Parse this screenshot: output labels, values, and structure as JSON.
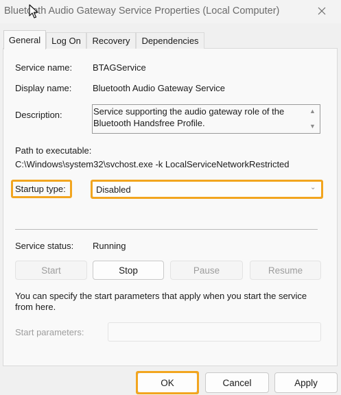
{
  "window": {
    "title": "Bluetooth Audio Gateway Service Properties (Local Computer)"
  },
  "tabs": [
    "General",
    "Log On",
    "Recovery",
    "Dependencies"
  ],
  "fields": {
    "service_name_label": "Service name:",
    "service_name_value": "BTAGService",
    "display_name_label": "Display name:",
    "display_name_value": "Bluetooth Audio Gateway Service",
    "description_label": "Description:",
    "description_line1": "Service supporting the audio gateway role of the",
    "description_line2": "Bluetooth Handsfree Profile.",
    "path_label": "Path to executable:",
    "path_value": "C:\\Windows\\system32\\svchost.exe -k LocalServiceNetworkRestricted",
    "startup_type_label": "Startup type:",
    "startup_type_value": "Disabled",
    "service_status_label": "Service status:",
    "service_status_value": "Running"
  },
  "control_buttons": {
    "start": "Start",
    "stop": "Stop",
    "pause": "Pause",
    "resume": "Resume"
  },
  "help_line1": "You can specify the start parameters that apply when you start the service",
  "help_line2": "from here.",
  "start_parameters_label": "Start parameters:",
  "footer": {
    "ok": "OK",
    "cancel": "Cancel",
    "apply": "Apply"
  },
  "colors": {
    "highlight": "#f2a51f"
  },
  "icons": [
    "close-icon",
    "mouse-cursor-icon",
    "scroll-up-icon",
    "scroll-down-icon",
    "chevron-down-icon"
  ]
}
